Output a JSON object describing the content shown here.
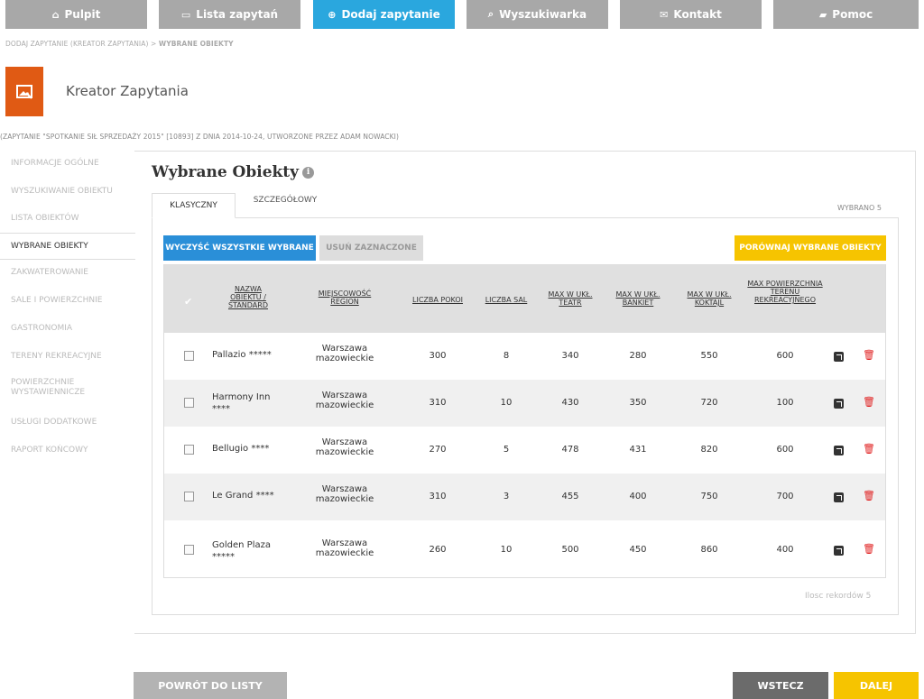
{
  "nav": {
    "items": [
      {
        "label": "Pulpit",
        "icon": "home-icon"
      },
      {
        "label": "Lista zapytań",
        "icon": "chat-icon"
      },
      {
        "label": "Dodaj zapytanie",
        "icon": "plus-circle-icon"
      },
      {
        "label": "Wyszukiwarka",
        "icon": "search-icon"
      },
      {
        "label": "Kontakt",
        "icon": "envelope-icon"
      },
      {
        "label": "Pomoc",
        "icon": "book-icon"
      }
    ]
  },
  "breadcrumb": {
    "path": "DODAJ ZAPYTANIE (KREATOR ZAPYTANIA) > ",
    "current": "WYBRANE OBIEKTY"
  },
  "kreator": {
    "title": "Kreator Zapytania"
  },
  "inquiry_info": "(ZAPYTANIE \"SPOTKANIE SIŁ SPRZEDAŻY 2015\" [10893] Z DNIA 2014-10-24, UTWORZONE PRZEZ ADAM NOWACKI)",
  "sidebar": {
    "items": [
      {
        "label": "INFORMACJE OGÓLNE"
      },
      {
        "label": "WYSZUKIWANIE OBIEKTU"
      },
      {
        "label": "LISTA OBIEKTÓW"
      },
      {
        "label": "WYBRANE OBIEKTY"
      },
      {
        "label": "ZAKWATEROWANIE"
      },
      {
        "label": "SALE I POWIERZCHNIE"
      },
      {
        "label": "GASTRONOMIA"
      },
      {
        "label": "TERENY REKREACYJNE"
      },
      {
        "label": "POWIERZCHNIE WYSTAWIENNICZE"
      },
      {
        "label": "USŁUGI DODATKOWE"
      },
      {
        "label": "RAPORT KOŃCOWY"
      }
    ]
  },
  "main": {
    "title": "Wybrane Obiekty",
    "tabs": [
      {
        "label": "KLASYCZNY"
      },
      {
        "label": "SZCZEGÓŁOWY"
      }
    ],
    "wybrano": "WYBRANO  5",
    "clear_all": "WYCZYŚĆ WSZYSTKIE WYBRANE",
    "remove_selected": "USUŃ ZAZNACZONE",
    "compare": "PORÓWNAJ WYBRANE OBIEKTY",
    "records": "Ilosc rekordów 5"
  },
  "table": {
    "headers": {
      "name": "NAZWA OBIEKTU / STANDARD",
      "city": "MIEJSCOWOŚĆ REGION",
      "rooms": "LICZBA POKOI",
      "halls": "LICZBA SAL",
      "theater": "MAX W UKŁ. TEATR",
      "banquet": "MAX W UKŁ. BANKIET",
      "cocktail": "MAX W UKŁ. KOKTAJL",
      "rec_area": "MAX POWIERZCHNIA TERENU REKREACYJNEGO"
    },
    "rows": [
      {
        "name": "Pallazio *****",
        "city": "Warszawa",
        "region": "mazowieckie",
        "rooms": "300",
        "halls": "8",
        "theater": "340",
        "banquet": "280",
        "cocktail": "550",
        "rec_area": "600"
      },
      {
        "name": "Harmony Inn ****",
        "city": "Warszawa",
        "region": "mazowieckie",
        "rooms": "310",
        "halls": "10",
        "theater": "430",
        "banquet": "350",
        "cocktail": "720",
        "rec_area": "100"
      },
      {
        "name": "Bellugio ****",
        "city": "Warszawa",
        "region": "mazowieckie",
        "rooms": "270",
        "halls": "5",
        "theater": "478",
        "banquet": "431",
        "cocktail": "820",
        "rec_area": "600"
      },
      {
        "name": "Le Grand ****",
        "city": "Warszawa",
        "region": "mazowieckie",
        "rooms": "310",
        "halls": "3",
        "theater": "455",
        "banquet": "400",
        "cocktail": "750",
        "rec_area": "700"
      },
      {
        "name": "Golden Plaza *****",
        "city": "Warszawa",
        "region": "mazowieckie",
        "rooms": "260",
        "halls": "10",
        "theater": "500",
        "banquet": "450",
        "cocktail": "860",
        "rec_area": "400"
      }
    ]
  },
  "footer": {
    "back_to_list": "POWRÓT DO LISTY",
    "back": "WSTECZ",
    "next": "DALEJ"
  },
  "colors": {
    "accent": "#2aa7de",
    "nav_grey": "#a8a8a8",
    "orange": "#e05a14",
    "yellow": "#f6c400",
    "blue_btn": "#2a8fd8",
    "dark_btn": "#6b6b6b"
  }
}
